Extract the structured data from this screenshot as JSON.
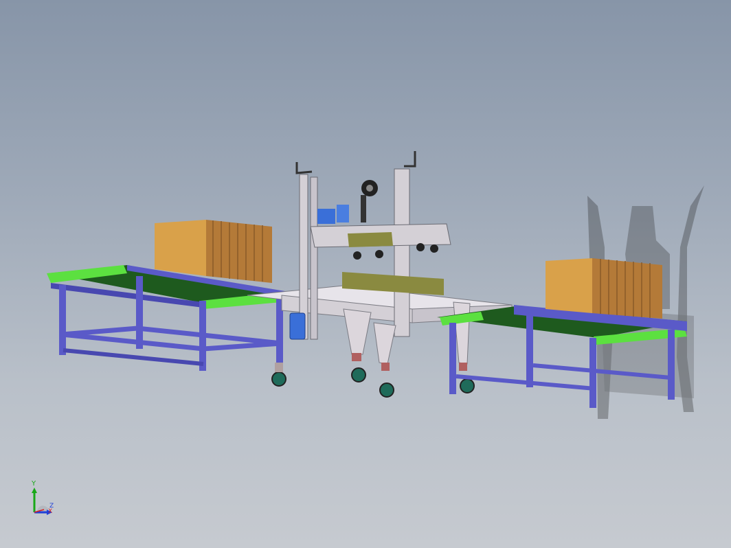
{
  "viewport": {
    "background_top": "#8795a8",
    "background_bottom": "#c6cad0"
  },
  "model": {
    "components": [
      "infeed-conveyor",
      "outfeed-conveyor",
      "carton-sealer-frame",
      "top-drive-head",
      "cardboard-box",
      "caster-wheel",
      "drive-motor"
    ],
    "colors": {
      "conveyor_frame": "#5a5ac8",
      "belt": "#1e5a1e",
      "roller_highlight": "#5ce040",
      "box": "#d9a14a",
      "machine_frame": "#d4d0d6",
      "motor": "#3a6fd8",
      "tape_head": "#8a8a40",
      "caster": "#1f6b5a"
    }
  },
  "triad": {
    "y_label": "Y",
    "x_label": "X",
    "z_label": "Z",
    "y_color": "#18a818",
    "x_color": "#d82020",
    "z_color": "#2040d8"
  }
}
